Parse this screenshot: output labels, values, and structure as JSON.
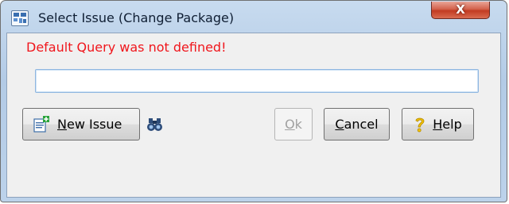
{
  "window": {
    "title": "Select Issue (Change Package)",
    "close_label": "X"
  },
  "message": {
    "text": "Default Query was not defined!",
    "color": "#f0161c"
  },
  "query_field": {
    "value": "",
    "placeholder": ""
  },
  "buttons": {
    "new_issue": {
      "mnemonic": "N",
      "rest": "ew Issue",
      "icon": "new-document-icon"
    },
    "find": {
      "icon": "binoculars-icon"
    },
    "ok": {
      "mnemonic": "O",
      "rest": "k",
      "disabled": true
    },
    "cancel": {
      "mnemonic": "C",
      "rest": "ancel"
    },
    "help": {
      "mnemonic": "H",
      "rest": "elp",
      "icon": "question-mark-icon"
    }
  },
  "colors": {
    "titlebar": "#b9d1ea",
    "client_bg": "#f0f0f0",
    "close_button": "#c23b22",
    "help_icon": "#f5c400"
  }
}
